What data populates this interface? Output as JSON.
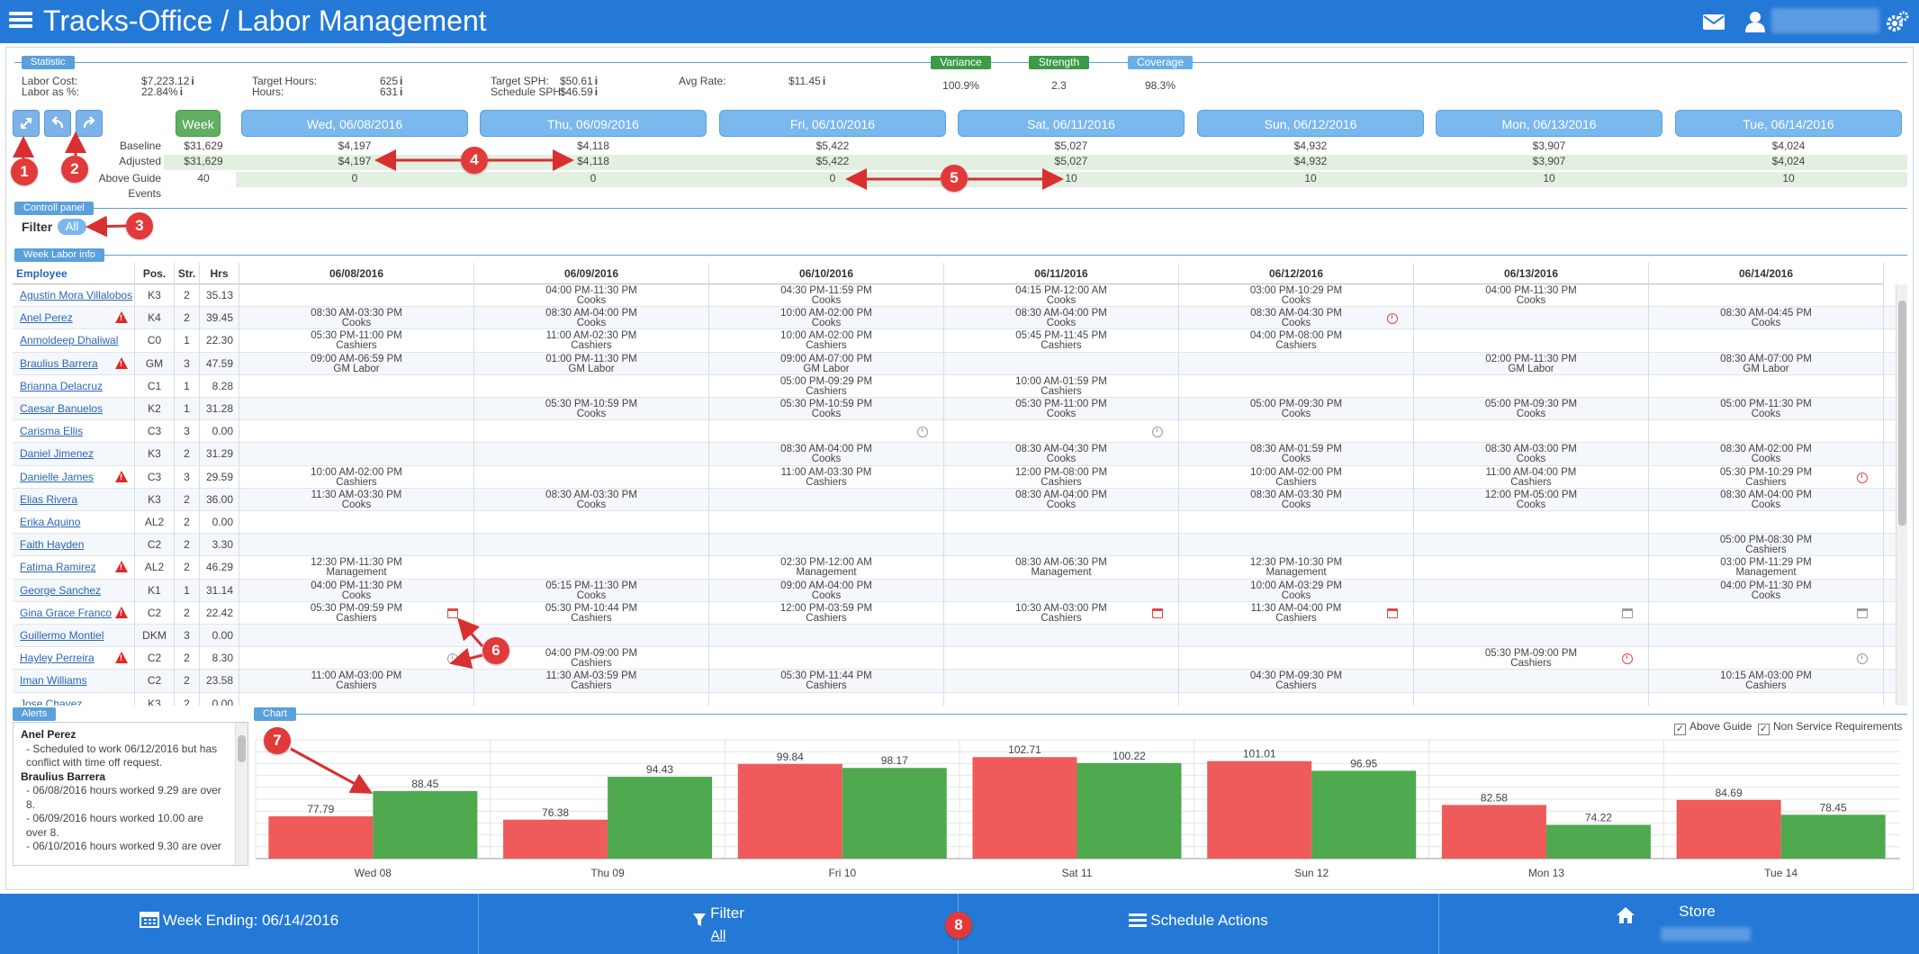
{
  "app": {
    "title": "Tracks-Office / Labor Management"
  },
  "sections": {
    "statistic": "Statistic",
    "control_panel": "Controll panel",
    "week_labor": "Week Labor info",
    "alerts": "Alerts",
    "chart": "Chart"
  },
  "stats": [
    {
      "label": "Labor Cost:",
      "value": "$7,223.12"
    },
    {
      "label": "Labor as %:",
      "value": "22.84%"
    },
    {
      "label": "Target Hours:",
      "value": "625"
    },
    {
      "label": "Hours:",
      "value": "631"
    },
    {
      "label": "Target SPH:",
      "value": "$50.61"
    },
    {
      "label": "Schedule SPH:",
      "value": "$46.59"
    },
    {
      "label": "Avg Rate:",
      "value": "$11.45"
    }
  ],
  "kpis": [
    {
      "label": "Variance",
      "value": "100.9%",
      "color": "#3c9a48"
    },
    {
      "label": "Strength",
      "value": "2.3",
      "color": "#3c9a48"
    },
    {
      "label": "Coverage",
      "value": "98.3%",
      "color": "#6aaee6"
    }
  ],
  "toolbar": {
    "week_label": "Week"
  },
  "days": [
    "Wed, 06/08/2016",
    "Thu, 06/09/2016",
    "Fri, 06/10/2016",
    "Sat, 06/11/2016",
    "Sun, 06/12/2016",
    "Mon, 06/13/2016",
    "Tue, 06/14/2016"
  ],
  "summary": {
    "labels": [
      "Baseline",
      "Adjusted",
      "Above Guide",
      "Events"
    ],
    "totals": [
      "$31,629",
      "$31,629",
      "40",
      ""
    ],
    "baseline": [
      "$4,197",
      "$4,118",
      "$5,422",
      "$5,027",
      "$4,932",
      "$3,907",
      "$4,024"
    ],
    "adjusted": [
      "$4,197",
      "$4,118",
      "$5,422",
      "$5,027",
      "$4,932",
      "$3,907",
      "$4,024"
    ],
    "above_guide": [
      "0",
      "0",
      "0",
      "10",
      "10",
      "10",
      "10"
    ]
  },
  "filter": {
    "label": "Filter",
    "value": "All"
  },
  "grid": {
    "headers": [
      "Employee",
      "Pos.",
      "Str.",
      "Hrs",
      "06/08/2016",
      "06/09/2016",
      "06/10/2016",
      "06/11/2016",
      "06/12/2016",
      "06/13/2016",
      "06/14/2016"
    ],
    "rows": [
      {
        "name": "Agustin Mora Villalobos",
        "pos": "K3",
        "str": "2",
        "hrs": "35.13",
        "warn": false,
        "shifts": [
          [
            "",
            ""
          ],
          [
            "04:00 PM-11:30 PM",
            "Cooks"
          ],
          [
            "04:30 PM-11:59 PM",
            "Cooks"
          ],
          [
            "04:15 PM-12:00 AM",
            "Cooks"
          ],
          [
            "03:00 PM-10:29 PM",
            "Cooks"
          ],
          [
            "04:00 PM-11:30 PM",
            "Cooks"
          ],
          [
            "",
            ""
          ]
        ]
      },
      {
        "name": "Anel Perez",
        "pos": "K4",
        "str": "2",
        "hrs": "39.45",
        "warn": true,
        "shifts": [
          [
            "08:30 AM-03:30 PM",
            "Cooks"
          ],
          [
            "08:30 AM-04:00 PM",
            "Cooks"
          ],
          [
            "10:00 AM-02:00 PM",
            "Cooks"
          ],
          [
            "08:30 AM-04:00 PM",
            "Cooks"
          ],
          [
            "08:30 AM-04:30 PM",
            "Cooks"
          ],
          [
            "",
            ""
          ],
          [
            "08:30 AM-04:45 PM",
            "Cooks"
          ]
        ]
      },
      {
        "name": "Anmoldeep Dhaliwal",
        "pos": "C0",
        "str": "1",
        "hrs": "22.30",
        "warn": false,
        "shifts": [
          [
            "05:30 PM-11:00 PM",
            "Cashiers"
          ],
          [
            "11:00 AM-02:30 PM",
            "Cashiers"
          ],
          [
            "10:00 AM-02:00 PM",
            "Cashiers"
          ],
          [
            "05:45 PM-11:45 PM",
            "Cashiers"
          ],
          [
            "04:00 PM-08:00 PM",
            "Cashiers"
          ],
          [
            "",
            ""
          ],
          [
            "",
            ""
          ]
        ]
      },
      {
        "name": "Braulius Barrera",
        "pos": "GM",
        "str": "3",
        "hrs": "47.59",
        "warn": true,
        "shifts": [
          [
            "09:00 AM-06:59 PM",
            "GM Labor"
          ],
          [
            "01:00 PM-11:30 PM",
            "GM Labor"
          ],
          [
            "09:00 AM-07:00 PM",
            "GM Labor"
          ],
          [
            "",
            ""
          ],
          [
            "",
            ""
          ],
          [
            "02:00 PM-11:30 PM",
            "GM Labor"
          ],
          [
            "08:30 AM-07:00 PM",
            "GM Labor"
          ]
        ]
      },
      {
        "name": "Brianna Delacruz",
        "pos": "C1",
        "str": "1",
        "hrs": "8.28",
        "warn": false,
        "shifts": [
          [
            "",
            ""
          ],
          [
            "",
            ""
          ],
          [
            "05:00 PM-09:29 PM",
            "Cashiers"
          ],
          [
            "10:00 AM-01:59 PM",
            "Cashiers"
          ],
          [
            "",
            ""
          ],
          [
            "",
            ""
          ],
          [
            "",
            ""
          ]
        ]
      },
      {
        "name": "Caesar Banuelos",
        "pos": "K2",
        "str": "1",
        "hrs": "31.28",
        "warn": false,
        "shifts": [
          [
            "",
            ""
          ],
          [
            "05:30 PM-10:59 PM",
            "Cooks"
          ],
          [
            "05:30 PM-10:59 PM",
            "Cooks"
          ],
          [
            "05:30 PM-11:00 PM",
            "Cooks"
          ],
          [
            "05:00 PM-09:30 PM",
            "Cooks"
          ],
          [
            "05:00 PM-09:30 PM",
            "Cooks"
          ],
          [
            "05:00 PM-11:30 PM",
            "Cooks"
          ]
        ]
      },
      {
        "name": "Carisma Ellis",
        "pos": "C3",
        "str": "3",
        "hrs": "0.00",
        "warn": false,
        "shifts": [
          [
            "",
            ""
          ],
          [
            "",
            ""
          ],
          [
            "",
            ""
          ],
          [
            "",
            ""
          ],
          [
            "",
            ""
          ],
          [
            "",
            ""
          ],
          [
            "",
            ""
          ]
        ]
      },
      {
        "name": "Daniel Jimenez",
        "pos": "K3",
        "str": "2",
        "hrs": "31.29",
        "warn": false,
        "shifts": [
          [
            "",
            ""
          ],
          [
            "",
            ""
          ],
          [
            "08:30 AM-04:00 PM",
            "Cooks"
          ],
          [
            "08:30 AM-04:30 PM",
            "Cooks"
          ],
          [
            "08:30 AM-01:59 PM",
            "Cooks"
          ],
          [
            "08:30 AM-03:00 PM",
            "Cooks"
          ],
          [
            "08:30 AM-02:00 PM",
            "Cooks"
          ]
        ]
      },
      {
        "name": "Danielle James",
        "pos": "C3",
        "str": "3",
        "hrs": "29.59",
        "warn": true,
        "shifts": [
          [
            "10:00 AM-02:00 PM",
            "Cashiers"
          ],
          [
            "",
            ""
          ],
          [
            "11:00 AM-03:30 PM",
            "Cashiers"
          ],
          [
            "12:00 PM-08:00 PM",
            "Cashiers"
          ],
          [
            "10:00 AM-02:00 PM",
            "Cashiers"
          ],
          [
            "11:00 AM-04:00 PM",
            "Cashiers"
          ],
          [
            "05:30 PM-10:29 PM",
            "Cashiers"
          ]
        ]
      },
      {
        "name": "Elias Rivera",
        "pos": "K3",
        "str": "2",
        "hrs": "36.00",
        "warn": false,
        "shifts": [
          [
            "11:30 AM-03:30 PM",
            "Cooks"
          ],
          [
            "08:30 AM-03:30 PM",
            "Cooks"
          ],
          [
            "",
            ""
          ],
          [
            "08:30 AM-04:00 PM",
            "Cooks"
          ],
          [
            "08:30 AM-03:30 PM",
            "Cooks"
          ],
          [
            "12:00 PM-05:00 PM",
            "Cooks"
          ],
          [
            "08:30 AM-04:00 PM",
            "Cooks"
          ]
        ]
      },
      {
        "name": "Erika Aquino",
        "pos": "AL2",
        "str": "2",
        "hrs": "0.00",
        "warn": false,
        "shifts": [
          [
            "",
            ""
          ],
          [
            "",
            ""
          ],
          [
            "",
            ""
          ],
          [
            "",
            ""
          ],
          [
            "",
            ""
          ],
          [
            "",
            ""
          ],
          [
            "",
            ""
          ]
        ]
      },
      {
        "name": "Faith Hayden",
        "pos": "C2",
        "str": "2",
        "hrs": "3.30",
        "warn": false,
        "shifts": [
          [
            "",
            ""
          ],
          [
            "",
            ""
          ],
          [
            "",
            ""
          ],
          [
            "",
            ""
          ],
          [
            "",
            ""
          ],
          [
            "",
            ""
          ],
          [
            "05:00 PM-08:30 PM",
            "Cashiers"
          ]
        ]
      },
      {
        "name": "Fatima Ramirez",
        "pos": "AL2",
        "str": "2",
        "hrs": "46.29",
        "warn": true,
        "shifts": [
          [
            "12:30 PM-11:30 PM",
            "Management"
          ],
          [
            "",
            ""
          ],
          [
            "02:30 PM-12:00 AM",
            "Management"
          ],
          [
            "08:30 AM-06:30 PM",
            "Management"
          ],
          [
            "12:30 PM-10:30 PM",
            "Management"
          ],
          [
            "",
            ""
          ],
          [
            "03:00 PM-11:29 PM",
            "Management"
          ]
        ]
      },
      {
        "name": "George Sanchez",
        "pos": "K1",
        "str": "1",
        "hrs": "31.14",
        "warn": false,
        "shifts": [
          [
            "04:00 PM-11:30 PM",
            "Cooks"
          ],
          [
            "05:15 PM-11:30 PM",
            "Cooks"
          ],
          [
            "09:00 AM-04:00 PM",
            "Cooks"
          ],
          [
            "",
            ""
          ],
          [
            "10:00 AM-03:29 PM",
            "Cooks"
          ],
          [
            "",
            ""
          ],
          [
            "04:00 PM-11:30 PM",
            "Cooks"
          ]
        ]
      },
      {
        "name": "Gina Grace Franco",
        "pos": "C2",
        "str": "2",
        "hrs": "22.42",
        "warn": true,
        "shifts": [
          [
            "05:30 PM-09:59 PM",
            "Cashiers"
          ],
          [
            "05:30 PM-10:44 PM",
            "Cashiers"
          ],
          [
            "12:00 PM-03:59 PM",
            "Cashiers"
          ],
          [
            "10:30 AM-03:00 PM",
            "Cashiers"
          ],
          [
            "11:30 AM-04:00 PM",
            "Cashiers"
          ],
          [
            "",
            ""
          ],
          [
            "",
            ""
          ]
        ]
      },
      {
        "name": "Guillermo Montiel",
        "pos": "DKM",
        "str": "3",
        "hrs": "0.00",
        "warn": false,
        "shifts": [
          [
            "",
            ""
          ],
          [
            "",
            ""
          ],
          [
            "",
            ""
          ],
          [
            "",
            ""
          ],
          [
            "",
            ""
          ],
          [
            "",
            ""
          ],
          [
            "",
            ""
          ]
        ]
      },
      {
        "name": "Hayley Perreira",
        "pos": "C2",
        "str": "2",
        "hrs": "8.30",
        "warn": true,
        "shifts": [
          [
            "",
            ""
          ],
          [
            "04:00 PM-09:00 PM",
            "Cashiers"
          ],
          [
            "",
            ""
          ],
          [
            "",
            ""
          ],
          [
            "",
            ""
          ],
          [
            "05:30 PM-09:00 PM",
            "Cashiers"
          ],
          [
            "",
            ""
          ]
        ]
      },
      {
        "name": "Iman Williams",
        "pos": "C2",
        "str": "2",
        "hrs": "23.58",
        "warn": false,
        "shifts": [
          [
            "11:00 AM-03:00 PM",
            "Cashiers"
          ],
          [
            "11:30 AM-03:59 PM",
            "Cashiers"
          ],
          [
            "05:30 PM-11:44 PM",
            "Cashiers"
          ],
          [
            "",
            ""
          ],
          [
            "04:30 PM-09:30 PM",
            "Cashiers"
          ],
          [
            "",
            ""
          ],
          [
            "10:15 AM-03:00 PM",
            "Cashiers"
          ]
        ]
      },
      {
        "name": "Jose Chavez",
        "pos": "K3",
        "str": "2",
        "hrs": "0.00",
        "warn": false,
        "shifts": [
          [
            "",
            ""
          ],
          [
            "",
            ""
          ],
          [
            "",
            ""
          ],
          [
            "",
            ""
          ],
          [
            "",
            ""
          ],
          [
            "",
            ""
          ],
          [
            "",
            ""
          ]
        ]
      }
    ]
  },
  "alerts": {
    "entries": [
      {
        "who": "Anel Perez",
        "lines": [
          "- Scheduled to work 06/12/2016 but has",
          "conflict with time off request."
        ]
      },
      {
        "who": "Braulius Barrera",
        "lines": [
          "- 06/08/2016 hours worked 9.29 are over",
          "8.",
          "- 06/09/2016 hours worked 10.00 are",
          "over 8.",
          "- 06/10/2016 hours worked 9.30 are over"
        ]
      }
    ]
  },
  "chart_data": {
    "type": "bar",
    "categories": [
      "Wed 08",
      "Thu 09",
      "Fri 10",
      "Sat 11",
      "Sun 12",
      "Mon 13",
      "Tue 14"
    ],
    "series": [
      {
        "values": [
          77.79,
          76.38,
          99.84,
          102.71,
          101.01,
          82.58,
          84.69
        ],
        "color": "#ef5a5a"
      },
      {
        "values": [
          88.45,
          94.43,
          98.17,
          100.22,
          96.95,
          74.22,
          78.45
        ],
        "color": "#4fa94f"
      }
    ],
    "ylim": [
      60,
      110
    ],
    "grid": true,
    "legend_items": [
      "Above Guide",
      "Non Service Requirements"
    ]
  },
  "bottom": {
    "week_ending": "Week Ending: 06/14/2016",
    "filter_label": "Filter",
    "filter_value": "All",
    "schedule_actions": "Schedule Actions",
    "store": "Store"
  },
  "annotations": [
    "1",
    "2",
    "3",
    "4",
    "5",
    "6",
    "7",
    "8"
  ]
}
